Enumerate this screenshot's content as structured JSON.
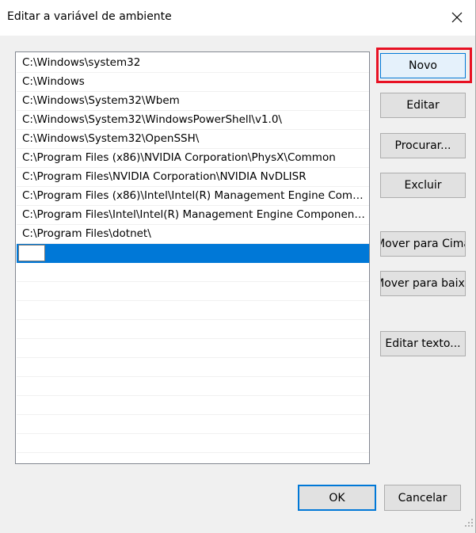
{
  "dialog": {
    "title": "Editar a variável de ambiente",
    "close_icon": "close-icon"
  },
  "list": {
    "items": [
      "C:\\Windows\\system32",
      "C:\\Windows",
      "C:\\Windows\\System32\\Wbem",
      "C:\\Windows\\System32\\WindowsPowerShell\\v1.0\\",
      "C:\\Windows\\System32\\OpenSSH\\",
      "C:\\Program Files (x86)\\NVIDIA Corporation\\PhysX\\Common",
      "C:\\Program Files\\NVIDIA Corporation\\NVIDIA NvDLISR",
      "C:\\Program Files (x86)\\Intel\\Intel(R) Management Engine Comp...",
      "C:\\Program Files\\Intel\\Intel(R) Management Engine Components...",
      "C:\\Program Files\\dotnet\\"
    ],
    "new_entry_value": ""
  },
  "buttons": {
    "novo": "Novo",
    "editar": "Editar",
    "procurar": "Procurar...",
    "excluir": "Excluir",
    "mover_cima": "Mover para Cima",
    "mover_baixo": "Mover para baixo",
    "editar_texto": "Editar texto...",
    "ok": "OK",
    "cancelar": "Cancelar"
  },
  "colors": {
    "selection": "#0078d7",
    "highlight_border": "#e81123",
    "focus_border": "#0078d7"
  }
}
